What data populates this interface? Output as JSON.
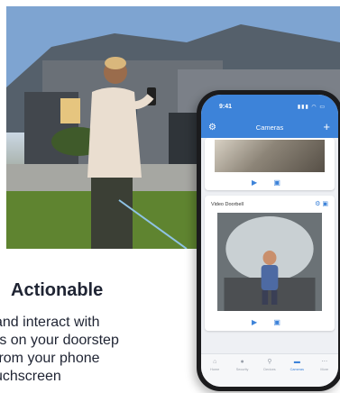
{
  "feature": {
    "heading": "Actionable",
    "body_lines": [
      "and interact with",
      "rs on your doorstep",
      "from your phone",
      "uchscreen"
    ]
  },
  "phone": {
    "status_time": "9:41",
    "status_icons": "▮▮▮ ◠ ▭",
    "header": {
      "title": "Cameras",
      "gear_icon": "⚙",
      "add_icon": "+"
    },
    "cards": {
      "top": {
        "actions": "▶ ▣"
      },
      "main": {
        "label": "Video Doorbell",
        "icons": "⚙ ▣",
        "actions": "▶ ▣"
      }
    },
    "tabs": [
      {
        "icon": "⌂",
        "label": "Home"
      },
      {
        "icon": "●",
        "label": "Security"
      },
      {
        "icon": "⚲",
        "label": "Devices"
      },
      {
        "icon": "▬",
        "label": "Cameras",
        "active": true
      },
      {
        "icon": "⋯",
        "label": "More"
      }
    ]
  }
}
